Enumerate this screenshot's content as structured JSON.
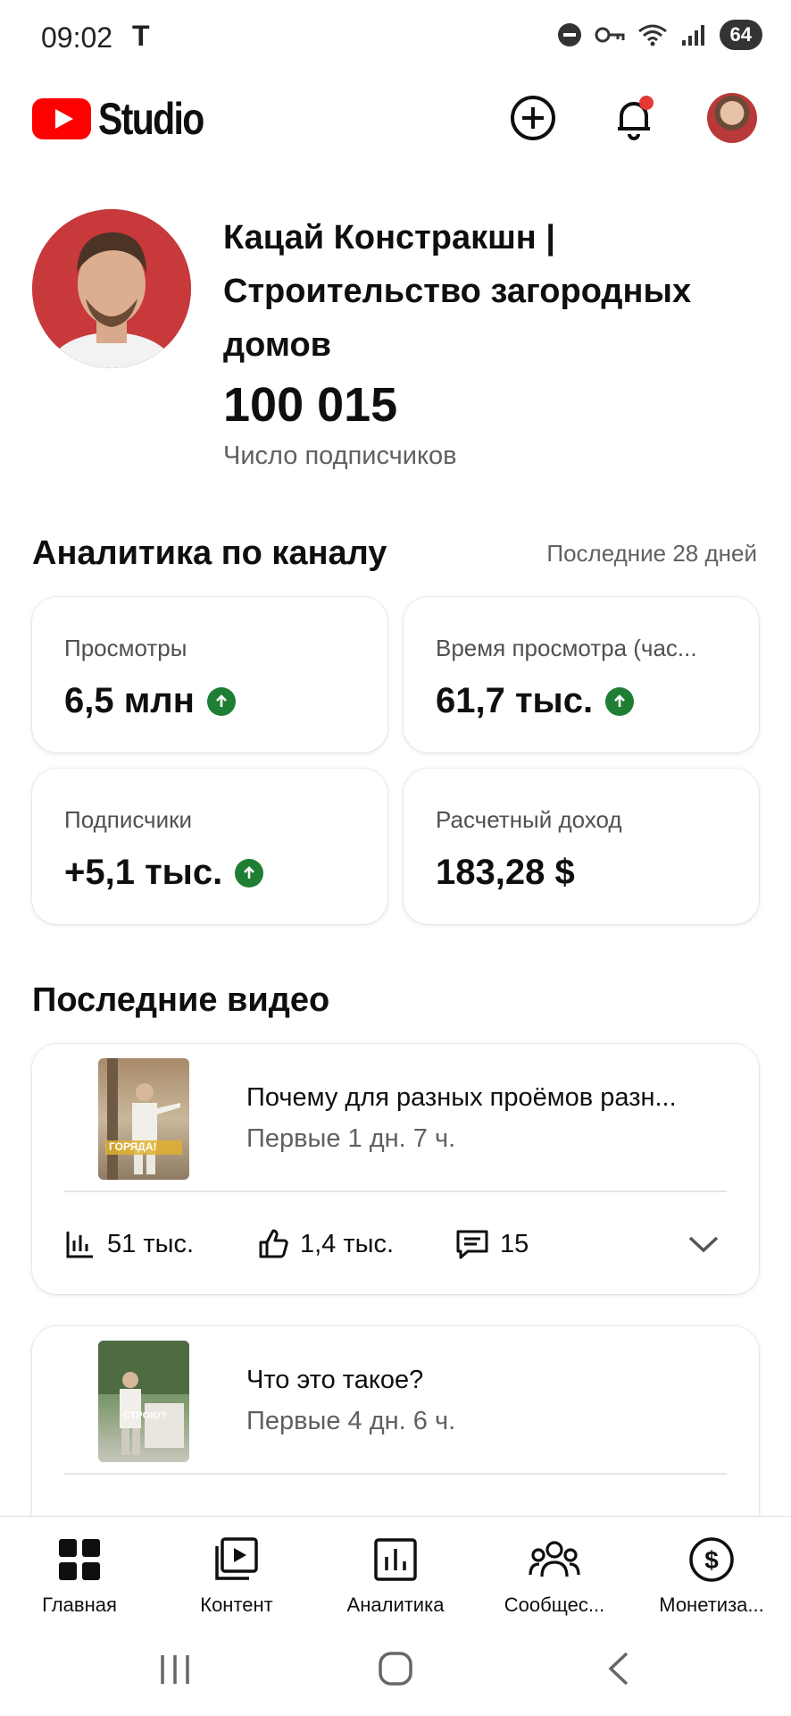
{
  "status_bar": {
    "time": "09:02",
    "carrier_glyph": "T",
    "battery": "64"
  },
  "app": {
    "logo_text": "Studio"
  },
  "channel": {
    "name": "Кацай Констракшн | Строительство загородных домов",
    "subscribers": "100 015",
    "subscribers_label": "Число подписчиков"
  },
  "analytics": {
    "title": "Аналитика по каналу",
    "period": "Последние 28 дней",
    "metrics": [
      {
        "label": "Просмотры",
        "value": "6,5 млн",
        "trend": "up"
      },
      {
        "label": "Время просмотра (час...",
        "value": "61,7 тыс.",
        "trend": "up"
      },
      {
        "label": "Подписчики",
        "value": "+5,1 тыс.",
        "trend": "up"
      },
      {
        "label": "Расчетный доход",
        "value": "183,28 $",
        "trend": "none"
      }
    ]
  },
  "videos": {
    "title": "Последние видео",
    "items": [
      {
        "title": "Почему для разных проёмов разн...",
        "subtitle": "Первые 1 дн. 7 ч.",
        "thumb_text": "ГОРЯДА!",
        "views": "51 тыс.",
        "likes": "1,4 тыс.",
        "comments": "15"
      },
      {
        "title": "Что это такое?",
        "subtitle": "Первые 4 дн. 6 ч.",
        "thumb_text": "СТРОЮ?"
      }
    ]
  },
  "bottom_nav": [
    {
      "label": "Главная",
      "icon": "dashboard-icon",
      "active": true
    },
    {
      "label": "Контент",
      "icon": "content-icon"
    },
    {
      "label": "Аналитика",
      "icon": "analytics-icon"
    },
    {
      "label": "Сообщес...",
      "icon": "community-icon"
    },
    {
      "label": "Монетиза...",
      "icon": "monetization-icon"
    }
  ],
  "colors": {
    "brand_red": "#ff0000",
    "trend_green": "#1e7e34",
    "notification_dot": "#e53935"
  }
}
